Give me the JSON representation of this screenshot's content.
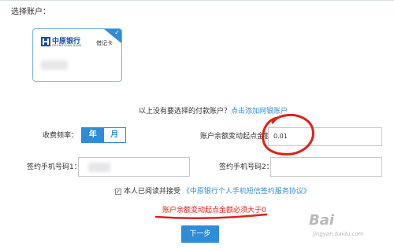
{
  "section": {
    "select_account_label": "选择账户："
  },
  "card": {
    "bank_name": "中原银行",
    "bank_name_en": "ZHONGYUAN BANK",
    "card_type": "借记卡",
    "check_icon": "checkmark-icon"
  },
  "hint": {
    "text": "以上没有要选择的付款账户？",
    "link": "点击添加网银账户"
  },
  "frequency": {
    "label": "收费频率：",
    "options": [
      "年",
      "月"
    ],
    "selected": "月"
  },
  "threshold": {
    "label": "账户余额变动起点金额",
    "value": "0.01"
  },
  "phone1": {
    "label": "签约手机号码1："
  },
  "phone2": {
    "label": "签约手机号码2：",
    "value": ""
  },
  "agreement": {
    "text": "本人已阅读并接受",
    "link": "《中原银行个人手机短信签约服务协议》",
    "checked": true
  },
  "error_message": "账户余额变动起点金额必须大于0",
  "next_button": "下一步",
  "watermark": {
    "main": "Bai",
    "sub": "jingyan.baidu.com"
  },
  "colors": {
    "accent": "#2f8dd7",
    "annotation": "#e0201a"
  }
}
